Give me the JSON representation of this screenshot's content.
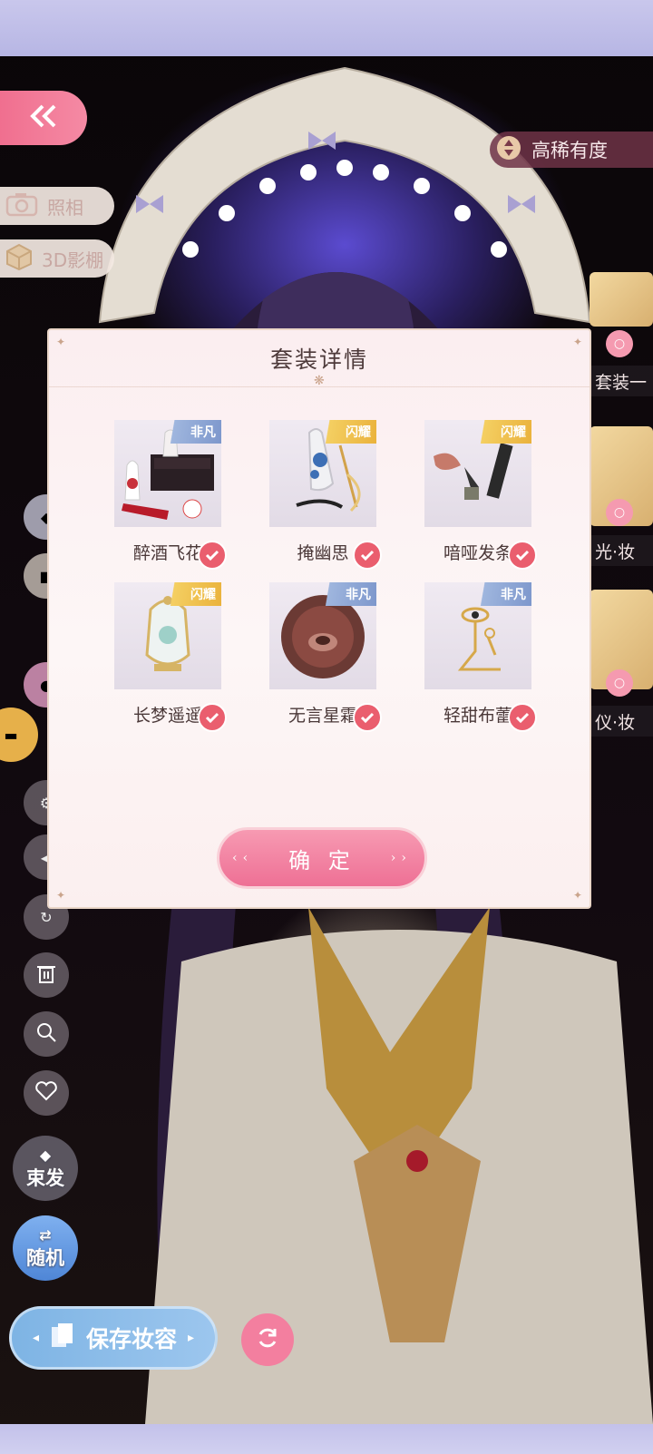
{
  "top_left": {
    "photo_label": "照相",
    "studio_label": "3D影棚"
  },
  "right_panel": {
    "title": "高稀有度",
    "side_labels": [
      "套装一",
      "光·妆",
      "仪·妆"
    ]
  },
  "modal": {
    "title": "套装详情",
    "items": [
      {
        "name": "醉酒飞花",
        "badge": "非凡",
        "selected": true,
        "icon": "makeup-box-icon"
      },
      {
        "name": "掩幽思",
        "badge": "闪耀",
        "selected": true,
        "icon": "perfume-eyelash-icon"
      },
      {
        "name": "喑哑发条",
        "badge": "闪耀",
        "selected": true,
        "icon": "eyeliner-icon"
      },
      {
        "name": "长梦遥遥",
        "badge": "闪耀",
        "selected": true,
        "icon": "golden-bottle-icon"
      },
      {
        "name": "无言星霜",
        "badge": "非凡",
        "selected": true,
        "icon": "lip-icon"
      },
      {
        "name": "轻甜布蕾",
        "badge": "非凡",
        "selected": true,
        "icon": "eye-ornament-icon"
      }
    ],
    "confirm_label": "确 定"
  },
  "left_tools": {
    "tie_hair_label": "束发",
    "random_label": "随机"
  },
  "bottom": {
    "save_label": "保存妆容"
  },
  "colors": {
    "accent_pink": "#f06f8f",
    "badge_blue": "#7d97cc",
    "badge_gold": "#eab23c",
    "check_red": "#ea5e6e"
  }
}
